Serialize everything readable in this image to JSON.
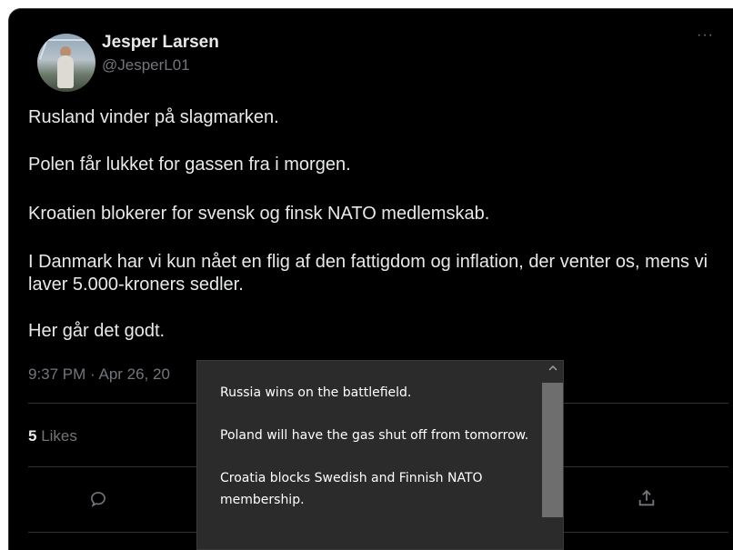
{
  "tweet": {
    "author": {
      "name": "Jesper Larsen",
      "handle": "@JesperL01"
    },
    "more_label": "···",
    "paragraphs": [
      "Rusland vinder på slagmarken.",
      "Polen får lukket for gassen fra i morgen.",
      "Kroatien blokerer for svensk og finsk NATO medlemskab.",
      "I Danmark har vi kun nået en flig af den fattigdom og inflation, der venter os, mens vi laver 5.000-kroners sedler.",
      "Her går det godt."
    ],
    "timestamp": "9:37 PM · Apr 26, 20",
    "likes": {
      "count": "5",
      "label": " Likes"
    },
    "actions": {
      "reply_icon": "reply-icon",
      "share_icon": "share-icon"
    }
  },
  "translation_tooltip": {
    "paragraphs": [
      "Russia wins on the battlefield.",
      "Poland will have the gas shut off from tomorrow.",
      "Croatia blocks Swedish and Finnish NATO membership."
    ],
    "scroll_up_icon": "chevron-up-icon"
  },
  "colors": {
    "background": "#000000",
    "primary_text": "#e7e9ea",
    "secondary_text": "#71767b",
    "divider": "#2f3336",
    "tooltip_bg": "#2b2b2b"
  }
}
